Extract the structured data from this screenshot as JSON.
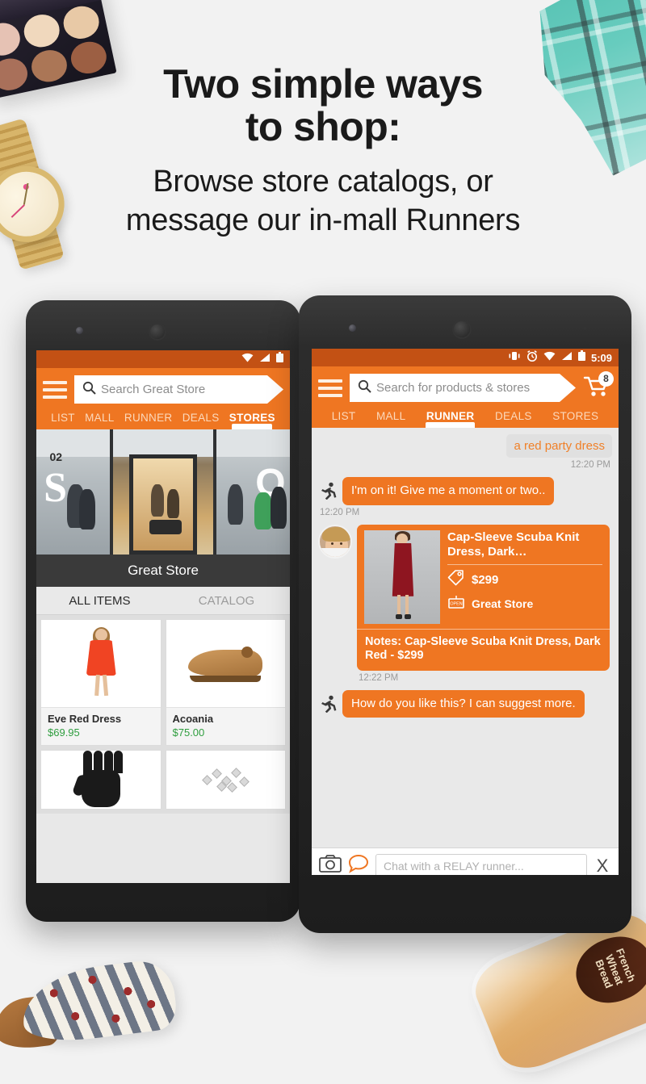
{
  "headline": {
    "line1": "Two simple ways",
    "line2": "to shop:",
    "line3": "Browse store catalogs, or",
    "line4": "message our in-mall Runners"
  },
  "colors": {
    "brand_orange": "#ef7622",
    "status_bar_orange": "#c35114",
    "price_green": "#2f9e3f",
    "chat_background": "#e9e9e9",
    "page_background": "#f2f2f2"
  },
  "props": {
    "top_left": "makeup-palette",
    "left": "gold-watch",
    "top_right": "teal-plaid-scarf",
    "bottom_left": "stars-and-stripes-shoe",
    "bottom_right": "french-wheat-bread",
    "bread_label": "French Wheat Bread"
  },
  "left_phone": {
    "statusbar": {
      "icons": [
        "wifi-icon",
        "signal-icon",
        "battery-icon"
      ],
      "time": ""
    },
    "appbar": {
      "menu_icon": "hamburger-icon",
      "search_placeholder": "Search Great Store",
      "search_icon": "search-icon"
    },
    "tabs": [
      {
        "label": "LIST",
        "active": false
      },
      {
        "label": "MALL",
        "active": false
      },
      {
        "label": "RUNNER",
        "active": false
      },
      {
        "label": "DEALS",
        "active": false
      },
      {
        "label": "STORES",
        "active": true
      }
    ],
    "store": {
      "name": "Great Store",
      "sign_02": "02",
      "sign_s": "S",
      "sign_o": "O"
    },
    "item_tabs": [
      {
        "label": "ALL ITEMS",
        "active": true
      },
      {
        "label": "CATALOG",
        "active": false
      }
    ],
    "products": [
      {
        "name": "Eve Red Dress",
        "price": "$69.95",
        "image": "red-dress"
      },
      {
        "name": "Acoania",
        "price": "$75.00",
        "image": "tan-loafer"
      },
      {
        "name": "",
        "price": "",
        "image": "black-gloves"
      },
      {
        "name": "",
        "price": "",
        "image": "jewelry"
      }
    ]
  },
  "right_phone": {
    "statusbar": {
      "icons": [
        "vibrate-icon",
        "alarm-icon",
        "wifi-icon",
        "signal-icon",
        "battery-icon"
      ],
      "time": "5:09"
    },
    "appbar": {
      "menu_icon": "hamburger-icon",
      "search_placeholder": "Search for products & stores",
      "search_icon": "search-icon",
      "cart_icon": "shopping-cart-icon",
      "cart_badge": "8"
    },
    "tabs": [
      {
        "label": "LIST",
        "active": false
      },
      {
        "label": "MALL",
        "active": false
      },
      {
        "label": "RUNNER",
        "active": true
      },
      {
        "label": "DEALS",
        "active": false
      },
      {
        "label": "STORES",
        "active": false
      }
    ],
    "chat": {
      "user_message": "a red party dress",
      "user_timestamp": "12:20 PM",
      "runner_message_1": "I'm on it! Give me a moment or two..",
      "runner_timestamp_1": "12:20 PM",
      "product_card": {
        "title": "Cap-Sleeve Scuba Knit Dress, Dark…",
        "price": "$299",
        "price_icon": "price-tag-icon",
        "store": "Great Store",
        "store_icon": "open-sign-icon",
        "notes": "Notes: Cap-Sleeve Scuba Knit Dress, Dark Red - $299",
        "image": "dark-red-dress"
      },
      "card_timestamp": "12:22 PM",
      "runner_message_2": "How do you like this? I can suggest more."
    },
    "composer": {
      "camera_icon": "camera-icon",
      "chat_icon": "chat-bubble-icon",
      "placeholder": "Chat with a RELAY runner...",
      "close_label": "X"
    }
  }
}
